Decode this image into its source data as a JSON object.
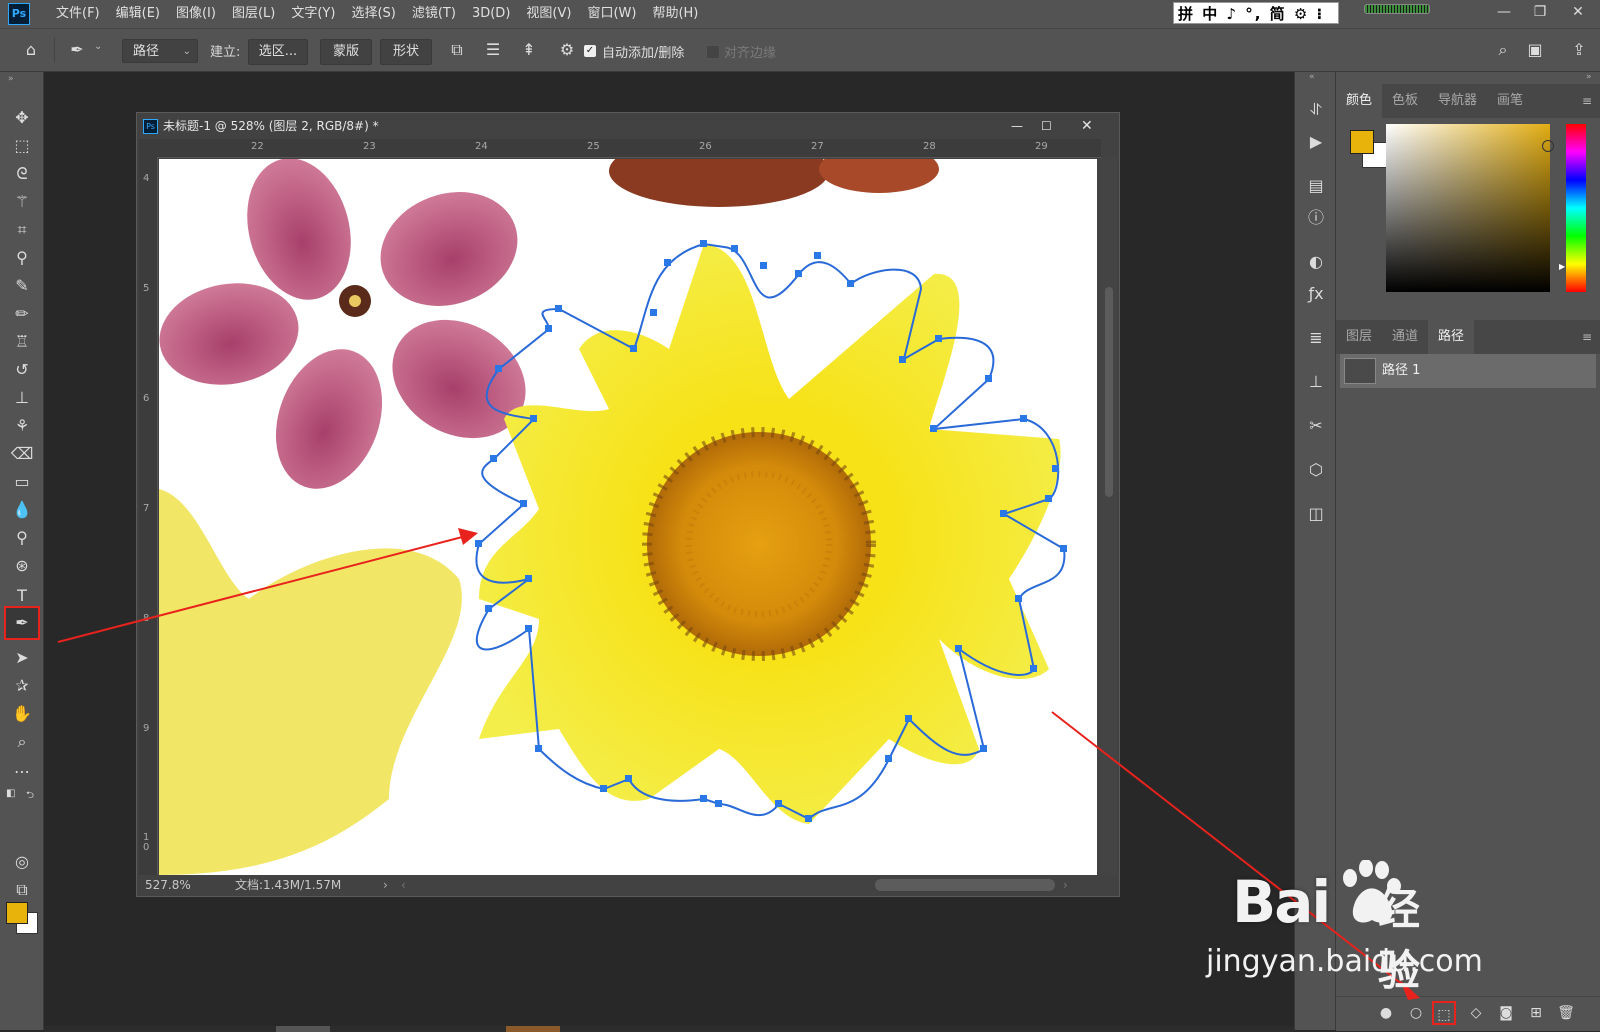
{
  "menubar": {
    "logo": "Ps",
    "items": [
      "文件(F)",
      "编辑(E)",
      "图像(I)",
      "图层(L)",
      "文字(Y)",
      "选择(S)",
      "滤镜(T)",
      "3D(D)",
      "视图(V)",
      "窗口(W)",
      "帮助(H)"
    ],
    "ime_text": "拼 中 ♪ °, 简 ⚙ ⁝"
  },
  "options": {
    "mode": "路径",
    "make_label": "建立:",
    "selection_button": "选区...",
    "mask_button": "蒙版",
    "shape_button": "形状",
    "auto_add_delete": "自动添加/删除",
    "align_edges": "对齐边缘"
  },
  "document": {
    "title": "未标题-1 @ 528% (图层 2, RGB/8#) *",
    "ruler_h": [
      "22",
      "23",
      "24",
      "25",
      "26",
      "27",
      "28",
      "29"
    ],
    "ruler_v": [
      "4",
      "5",
      "6",
      "7",
      "8",
      "9",
      "1\n0"
    ],
    "zoom": "527.8%",
    "doc_size": "文档:1.43M/1.57M"
  },
  "color_panel": {
    "tabs": [
      "颜色",
      "色板",
      "导航器",
      "画笔"
    ],
    "foreground": "#e8b40c",
    "background": "#ffffff"
  },
  "layers_panel": {
    "tabs": [
      "图层",
      "通道",
      "路径"
    ],
    "active_tab": "路径",
    "path_name": "路径 1"
  },
  "toolbar": {
    "foreground": "#e8b40c",
    "background": "#ffffff"
  },
  "watermark": {
    "brand": "Bai",
    "brand_suffix": "经验",
    "url": "jingyan.baidu.com"
  }
}
